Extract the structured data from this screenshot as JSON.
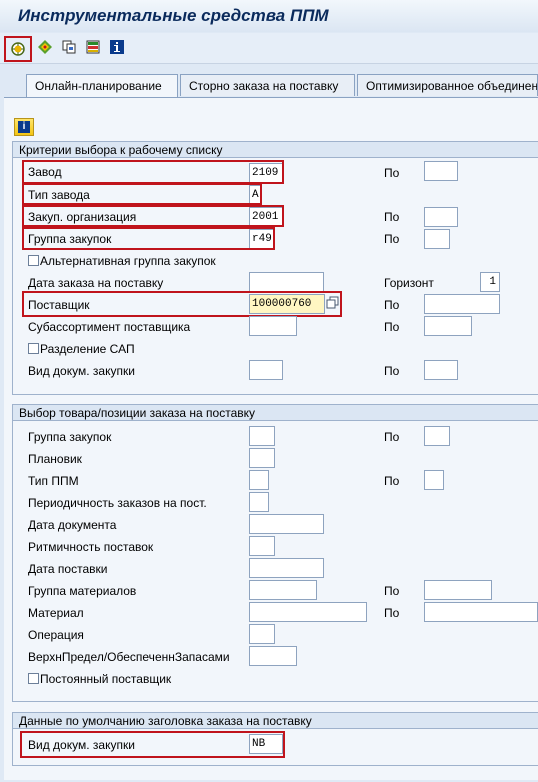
{
  "title": "Инструментальные средства ППМ",
  "toolbar": {
    "icons": [
      "execute-icon",
      "variant-icon",
      "copy-icon",
      "layout-icon",
      "info-icon"
    ]
  },
  "tabs": [
    "Онлайн-планирование",
    "Сторно заказа на поставку",
    "Оптимизированное объединение"
  ],
  "info_button_icon": "info-icon",
  "selection_criteria": {
    "header": "Критерии выбора к рабочему списку",
    "plant_label": "Завод",
    "plant_value": "2109",
    "plant_type_label": "Тип завода",
    "plant_type_value": "A",
    "purch_org_label": "Закуп. организация",
    "purch_org_value": "2001",
    "purch_group_label": "Группа закупок",
    "purch_group_value": "r49",
    "alt_purch_group_label": "Альтернативная группа закупок",
    "po_date_label": "Дата заказа на поставку",
    "horizon_label": "Горизонт",
    "horizon_value": "1",
    "vendor_label": "Поставщик",
    "vendor_value": "100000760",
    "vendor_subrange_label": "Субассортимент поставщика",
    "sap_split_label": "Разделение САП",
    "doc_type_label": "Вид докум. закупки",
    "to_label": "По"
  },
  "item_selection": {
    "header": "Выбор товара/позиции заказа на поставку",
    "purch_group_label": "Группа закупок",
    "planner_label": "Плановик",
    "mrp_type_label": "Тип ППМ",
    "order_freq_label": "Периодичность заказов на пост.",
    "doc_date_label": "Дата документа",
    "delivery_rhythm_label": "Ритмичность поставок",
    "delivery_date_label": "Дата поставки",
    "mat_group_label": "Группа материалов",
    "material_label": "Материал",
    "operation_label": "Операция",
    "upper_limit_label": "ВерхнПредел/ОбеспеченнЗапасами",
    "regular_vendor_label": "Постоянный поставщик",
    "to_label": "По"
  },
  "defaults": {
    "header": "Данные по умолчанию заголовка заказа на поставку",
    "doc_type_label": "Вид докум. закупки",
    "doc_type_value": "NB"
  }
}
